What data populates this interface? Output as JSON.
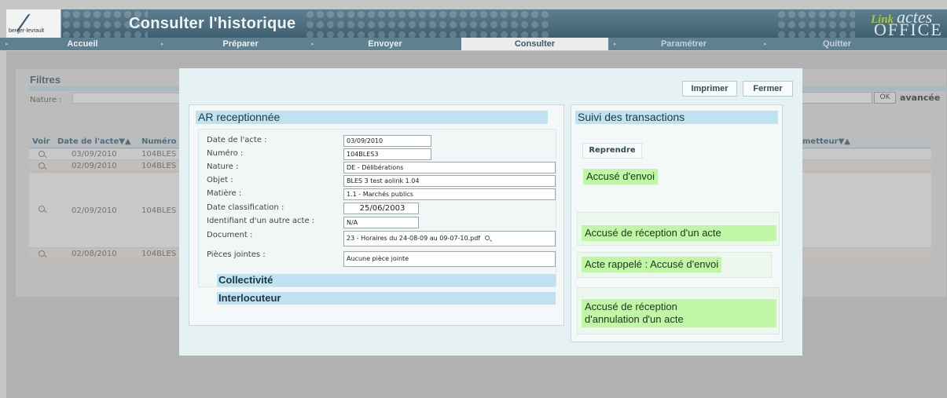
{
  "header": {
    "brand": "berger-levrault",
    "title": "Consulter l'historique",
    "product_link": "Link",
    "product_actes": "actes",
    "product_office": "OFFICE"
  },
  "nav": {
    "accueil": "Accueil",
    "preparer": "Préparer",
    "envoyer": "Envoyer",
    "consulter": "Consulter",
    "parametrer": "Paramétrer",
    "quitter": "Quitter",
    "separator": "▸"
  },
  "filters": {
    "title": "Filtres",
    "nature_label": "Nature :",
    "ok_label": "OK",
    "advanced_label": "avancée"
  },
  "table": {
    "headers": {
      "voir": "Voir",
      "date": "Date de l'acte▼▲",
      "numero": "Numéro",
      "emetteur": "metteur▼▲"
    },
    "rows": [
      {
        "date": "03/09/2010",
        "numero": "104BLES"
      },
      {
        "date": "02/09/2010",
        "numero": "104BLES"
      },
      {
        "date": "02/09/2010",
        "numero": "104BLES"
      },
      {
        "date": "02/08/2010",
        "numero": "104BLES"
      }
    ]
  },
  "modal": {
    "print_label": "Imprimer",
    "close_label": "Fermer",
    "ar_title": "AR receptionnée",
    "fields": [
      {
        "label": "Date de l'acte :",
        "value": "03/09/2010"
      },
      {
        "label": "Numéro :",
        "value": "104BLES3"
      },
      {
        "label": "Nature :",
        "value": "DE - Délibérations"
      },
      {
        "label": "Objet :",
        "value": "BLES 3 test aolink 1.04"
      },
      {
        "label": "Matière :",
        "value": "1.1 - Marchés publics"
      },
      {
        "label": "Date classification :",
        "value": "25/06/2003"
      },
      {
        "label": "Identifiant d'un autre acte :",
        "value": "N/A"
      },
      {
        "label": "Document :",
        "value": "23 - Horaires du 24-08-09 au 09-07-10.pdf"
      },
      {
        "label": "Pièces jointes :",
        "value": "Aucune pièce jointe"
      }
    ],
    "collectivite_label": "Collectivité",
    "interlocuteur_label": "Interlocuteur",
    "suivi_title": "Suivi des transactions",
    "reprendre_label": "Reprendre",
    "transactions": [
      {
        "label": "Accusé d'envoi"
      },
      {
        "label": "Accusé de réception d'un acte"
      },
      {
        "label": "Acte rappelé : Accusé d'envoi"
      },
      {
        "label": "Accusé de réception\nd'annulation d'un acte"
      }
    ]
  },
  "colors": {
    "header_bg": "#4f7080",
    "nav_bg": "#5f8090",
    "section_title_bg": "#bfe2f1",
    "transaction_bg": "#bff7a6",
    "modal_bg": "#e6f1f4"
  }
}
